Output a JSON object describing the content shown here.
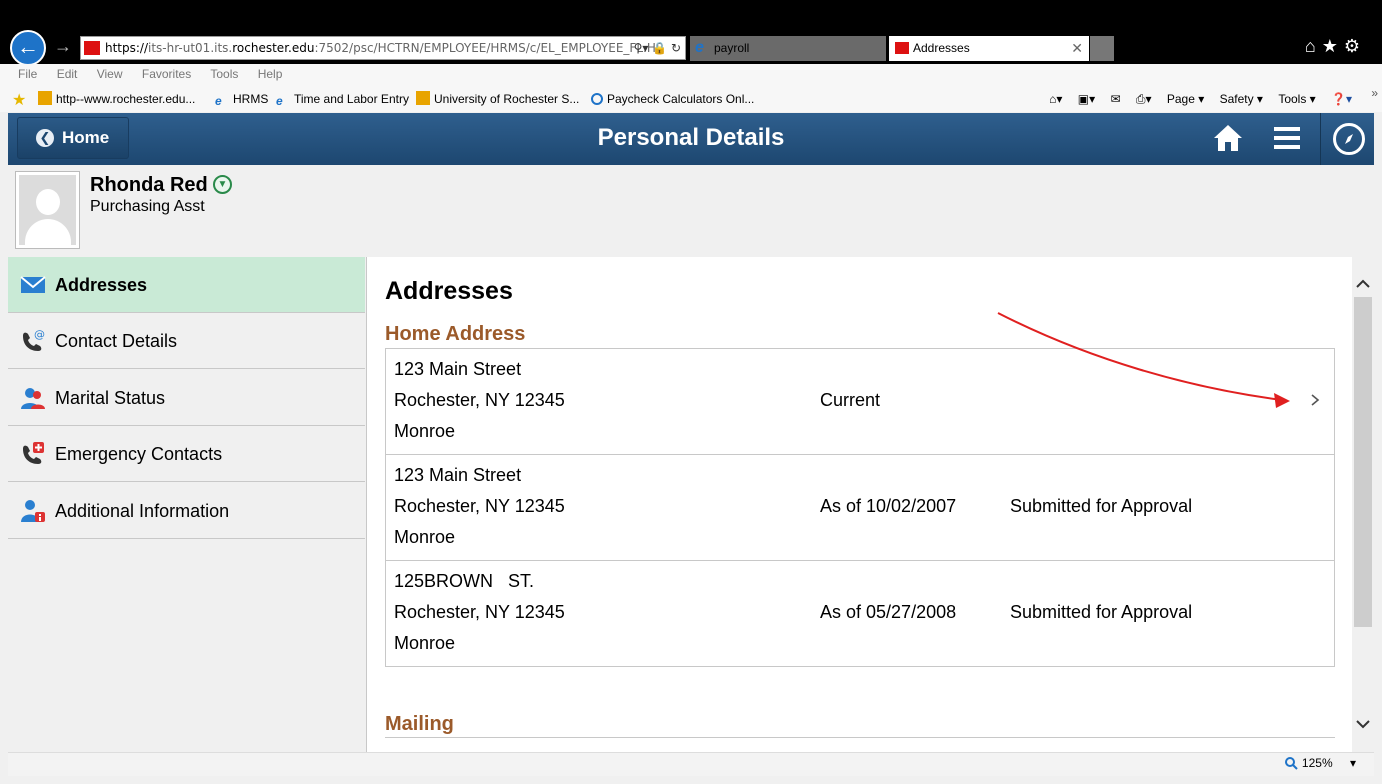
{
  "browser": {
    "url_prefix": "https://",
    "url_host_pre": "its-hr-ut01.its.",
    "url_host_bold": "rochester.edu",
    "url_rest": ":7502/psc/HCTRN/EMPLOYEE/HRMS/c/EL_EMPLOYEE_FL.HR",
    "tabs": [
      {
        "label": "payroll"
      },
      {
        "label": "Addresses"
      }
    ],
    "menu": [
      "File",
      "Edit",
      "View",
      "Favorites",
      "Tools",
      "Help"
    ],
    "favorites": [
      "http--www.rochester.edu...",
      "HRMS",
      "Time and Labor Entry",
      "University of Rochester  S...",
      "Paycheck Calculators  Onl..."
    ],
    "commands": [
      "Page ▾",
      "Safety ▾",
      "Tools ▾"
    ],
    "zoom": "125%"
  },
  "header": {
    "home_label": "Home",
    "title": "Personal Details"
  },
  "profile": {
    "name": "Rhonda Red",
    "job_title": "Purchasing Asst"
  },
  "nav": [
    {
      "label": "Addresses",
      "icon": "envelope-icon"
    },
    {
      "label": "Contact Details",
      "icon": "phone-at-icon"
    },
    {
      "label": "Marital Status",
      "icon": "people-icon"
    },
    {
      "label": "Emergency Contacts",
      "icon": "emergency-phone-icon"
    },
    {
      "label": "Additional Information",
      "icon": "person-info-icon"
    }
  ],
  "main": {
    "heading": "Addresses",
    "home_section": "Home Address",
    "mailing_section": "Mailing",
    "addresses": [
      {
        "line1": "123 Main Street",
        "line2": "Rochester, NY 12345",
        "county": "Monroe",
        "effective": "Current",
        "status": ""
      },
      {
        "line1": "123 Main Street",
        "line2": "Rochester, NY 12345",
        "county": "Monroe",
        "effective": "As of 10/02/2007",
        "status": "Submitted for Approval"
      },
      {
        "line1": "125BROWN   ST.",
        "line2": "Rochester, NY 12345",
        "county": "Monroe",
        "effective": "As of 05/27/2008",
        "status": "Submitted for Approval"
      }
    ]
  },
  "colors": {
    "header_blue": "#1d4770",
    "section_brown": "#9b5a2a",
    "selected_nav": "#c9ead6",
    "annotation_red": "#e02020"
  }
}
